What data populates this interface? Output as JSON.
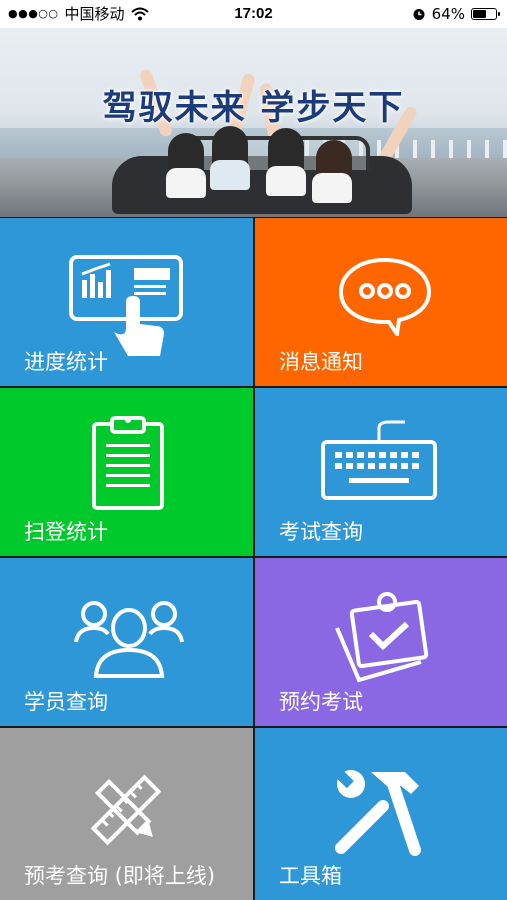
{
  "status_bar": {
    "signal_dots": "●●●○○",
    "carrier": "中国移动",
    "wifi_icon": "wifi-icon",
    "time": "17:02",
    "alarm_icon": "alarm-clock-icon",
    "battery": "64%",
    "battery_level": 0.64
  },
  "banner": {
    "title": "驾驭未来 学步天下"
  },
  "tiles": [
    {
      "label": "进度统计",
      "icon": "tablet-chart-icon",
      "color": "#2e97d8"
    },
    {
      "label": "消息通知",
      "icon": "chat-bubble-icon",
      "color": "#ff6600"
    },
    {
      "label": "扫登统计",
      "icon": "clipboard-icon",
      "color": "#00c92c"
    },
    {
      "label": "考试查询",
      "icon": "keyboard-icon",
      "color": "#2e97d8"
    },
    {
      "label": "学员查询",
      "icon": "people-icon",
      "color": "#2e97d8"
    },
    {
      "label": "预约考试",
      "icon": "calendar-check-icon",
      "color": "#8a68e4"
    },
    {
      "label": "预考查询 (即将上线)",
      "icon": "ruler-pencil-icon",
      "color": "#9f9f9f"
    },
    {
      "label": "工具箱",
      "icon": "tools-icon",
      "color": "#2e97d8"
    }
  ]
}
